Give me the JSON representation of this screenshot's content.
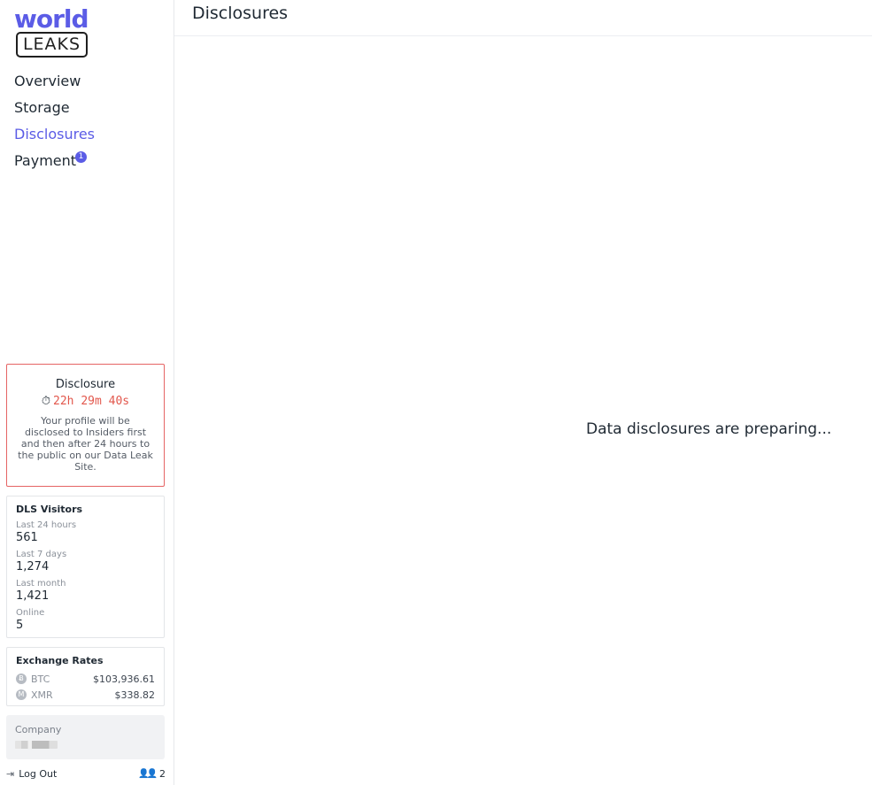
{
  "logo": {
    "word1": "world",
    "word2": "LEAKS"
  },
  "nav": {
    "overview": "Overview",
    "storage": "Storage",
    "disclosures": "Disclosures",
    "payment": "Payment",
    "payment_badge": "1"
  },
  "disclosure_card": {
    "title": "Disclosure",
    "timer": "22h 29m 40s",
    "text": "Your profile will be disclosed to Insiders first and then after 24 hours to the public on our Data Leak Site."
  },
  "visitors": {
    "title": "DLS Visitors",
    "stats": [
      {
        "label": "Last 24 hours",
        "value": "561"
      },
      {
        "label": "Last 7 days",
        "value": "1,274"
      },
      {
        "label": "Last month",
        "value": "1,421"
      },
      {
        "label": "Online",
        "value": "5"
      }
    ]
  },
  "rates": {
    "title": "Exchange Rates",
    "items": [
      {
        "symbol": "BTC",
        "value": "$103,936.61",
        "icon": "btc-icon",
        "glyph": "Ƀ"
      },
      {
        "symbol": "XMR",
        "value": "$338.82",
        "icon": "xmr-icon",
        "glyph": "M"
      }
    ]
  },
  "company": {
    "label": "Company"
  },
  "footer": {
    "logout": "Log Out",
    "users_count": "2"
  },
  "header": {
    "title": "Disclosures"
  },
  "main": {
    "empty_message": "Data disclosures are preparing..."
  },
  "colors": {
    "accent": "#5b5ce6",
    "timer": "#e2574c",
    "danger_border": "#e56464"
  }
}
